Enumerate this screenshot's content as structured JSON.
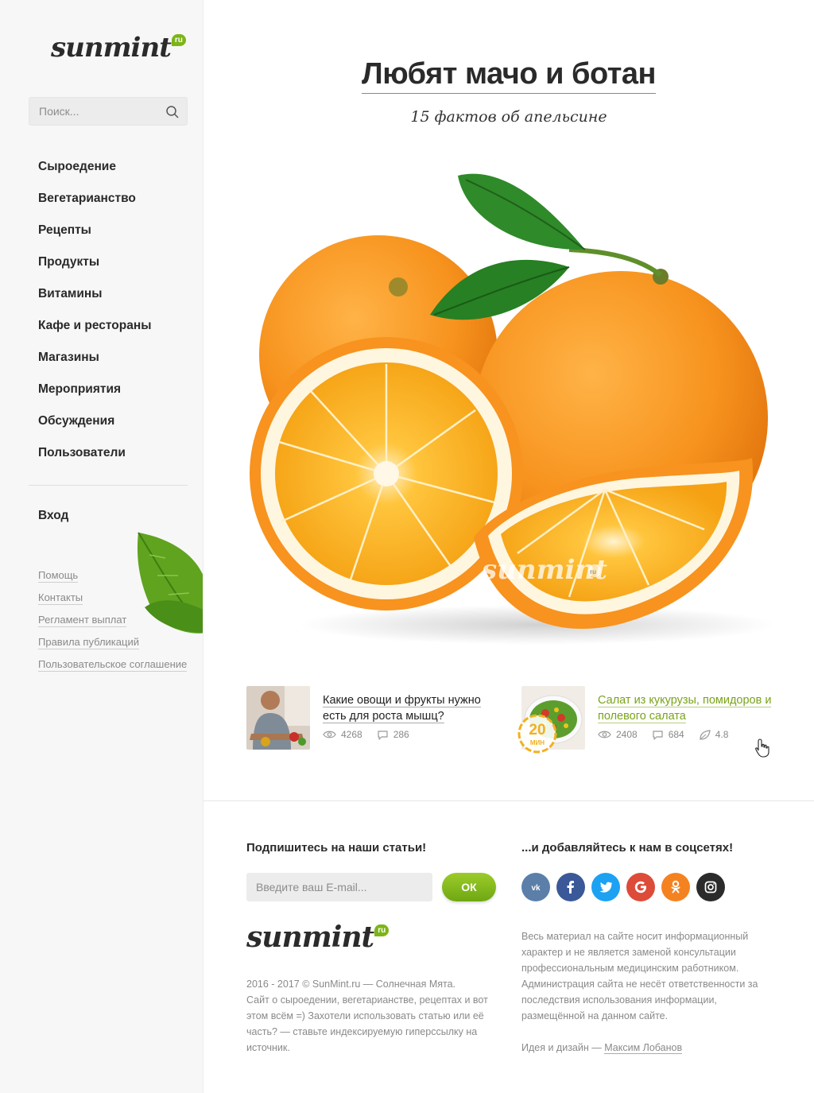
{
  "sidebar": {
    "logo": {
      "text": "sunmint",
      "ru": "ru"
    },
    "search": {
      "placeholder": "Поиск..."
    },
    "nav": [
      "Сыроедение",
      "Вегетарианство",
      "Рецепты",
      "Продукты",
      "Витамины",
      "Кафе и рестораны",
      "Магазины",
      "Мероприятия",
      "Обсуждения",
      "Пользователи"
    ],
    "login": "Вход",
    "links": [
      "Помощь",
      "Контакты",
      "Регламент выплат",
      "Правила публикаций",
      "Пользовательское соглашение"
    ]
  },
  "article": {
    "title": "Любят мачо и ботан",
    "subtitle": "15 фактов об апельсине",
    "watermark": "sunmint",
    "watermark_ru": "ru"
  },
  "related": [
    {
      "title": "Какие овощи и фрукты нужно есть для роста мышц?",
      "views": "4268",
      "comments": "286"
    },
    {
      "title": "Салат из кукурузы, помидоров и полевого салата",
      "views": "2408",
      "comments": "684",
      "rating": "4.8",
      "badge_num": "20",
      "badge_unit": "МИН"
    }
  ],
  "footer": {
    "subscribe_title": "Подпишитесь на наши статьи!",
    "email_placeholder": "Введите ваш E-mail...",
    "ok_label": "ОК",
    "social_title": "...и добавляйтесь к нам в соцсетях!",
    "social": [
      {
        "name": "vk",
        "label": "vk",
        "color": "#5b7fa8"
      },
      {
        "name": "facebook",
        "label": "f",
        "color": "#3b5998"
      },
      {
        "name": "twitter",
        "label": "twitter",
        "color": "#1da1f2"
      },
      {
        "name": "google",
        "label": "G",
        "color": "#dd4b39"
      },
      {
        "name": "odnoklassniki",
        "label": "ok",
        "color": "#f58220"
      },
      {
        "name": "instagram",
        "label": "ig",
        "color": "#2b2b2b"
      }
    ],
    "logo": {
      "text": "sunmint",
      "ru": "ru"
    },
    "copyright": "2016 - 2017 © SunMint.ru — Солнечная Мята.",
    "about": "Сайт о сыроедении, вегетарианстве, рецептах и вот этом всём =) Захотели использовать статью или её часть? — ставьте индексируемую гиперссылку на источник.",
    "disclaimer": "Весь материал на сайте носит информационный характер и не является заменой консультации профессиональным медицинским работником. Администрация сайта не несёт ответственности за последствия использования информации, размещённой на данном сайте.",
    "credit_prefix": "Идея и дизайн —",
    "author": "Максим Лобанов"
  },
  "colors": {
    "accent": "#7cb518",
    "link_green": "#7aa31a",
    "sidebar_bg": "#f7f7f7"
  }
}
